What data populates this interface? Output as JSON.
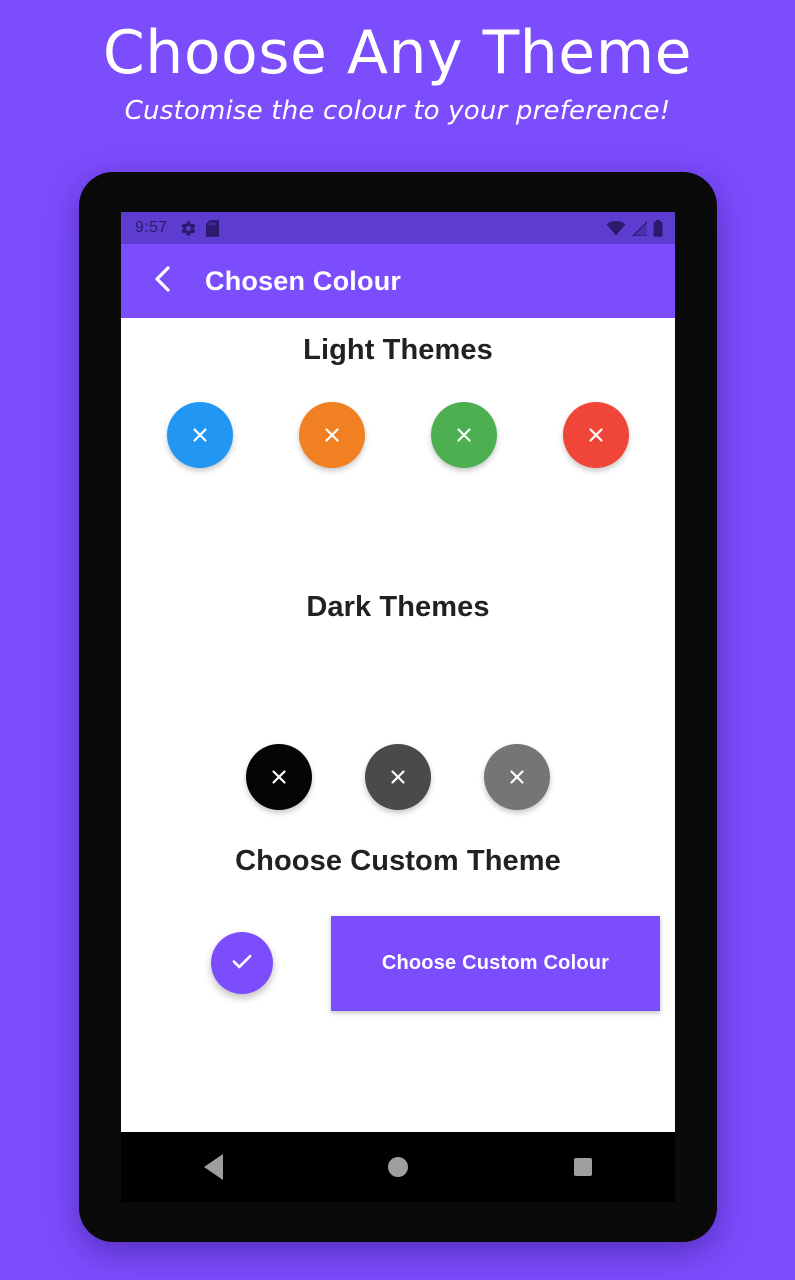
{
  "promo": {
    "title": "Choose Any Theme",
    "subtitle": "Customise the colour to your preference!"
  },
  "colors": {
    "background_purple": "#7c4dfd",
    "statusbar_purple": "#5c3dd0",
    "appbar_purple": "#7c4dfd",
    "accent_purple": "#7c4dfd",
    "content_white": "#ffffff",
    "navbar_black": "#000000"
  },
  "statusbar": {
    "time": "9:57",
    "left_icons": [
      "gear-icon",
      "sd-card-icon"
    ],
    "right_icons": [
      "wifi-icon",
      "cellular-signal-icon",
      "battery-icon"
    ]
  },
  "appbar": {
    "back_icon": "chevron-left-icon",
    "title": "Chosen Colour"
  },
  "sections": {
    "light": {
      "title": "Light Themes",
      "swatches": [
        {
          "name": "blue",
          "color": "#2196f3",
          "icon": "close-x-icon"
        },
        {
          "name": "orange",
          "color": "#f08021",
          "icon": "close-x-icon"
        },
        {
          "name": "green",
          "color": "#4caf50",
          "icon": "close-x-icon"
        },
        {
          "name": "red",
          "color": "#f0463a",
          "icon": "close-x-icon"
        }
      ]
    },
    "dark": {
      "title": "Dark Themes",
      "swatches": [
        {
          "name": "black",
          "color": "#050505",
          "icon": "close-x-icon"
        },
        {
          "name": "dark-grey",
          "color": "#4a4a4a",
          "icon": "close-x-icon"
        },
        {
          "name": "grey",
          "color": "#757575",
          "icon": "close-x-icon"
        }
      ]
    },
    "custom": {
      "title": "Choose Custom Theme",
      "selected_swatch": {
        "name": "custom-purple",
        "color": "#7c4dfd",
        "icon": "check-icon"
      },
      "button_label": "Choose Custom Colour"
    }
  },
  "navbar": {
    "back_label": "Back",
    "home_label": "Home",
    "recents_label": "Recents"
  }
}
